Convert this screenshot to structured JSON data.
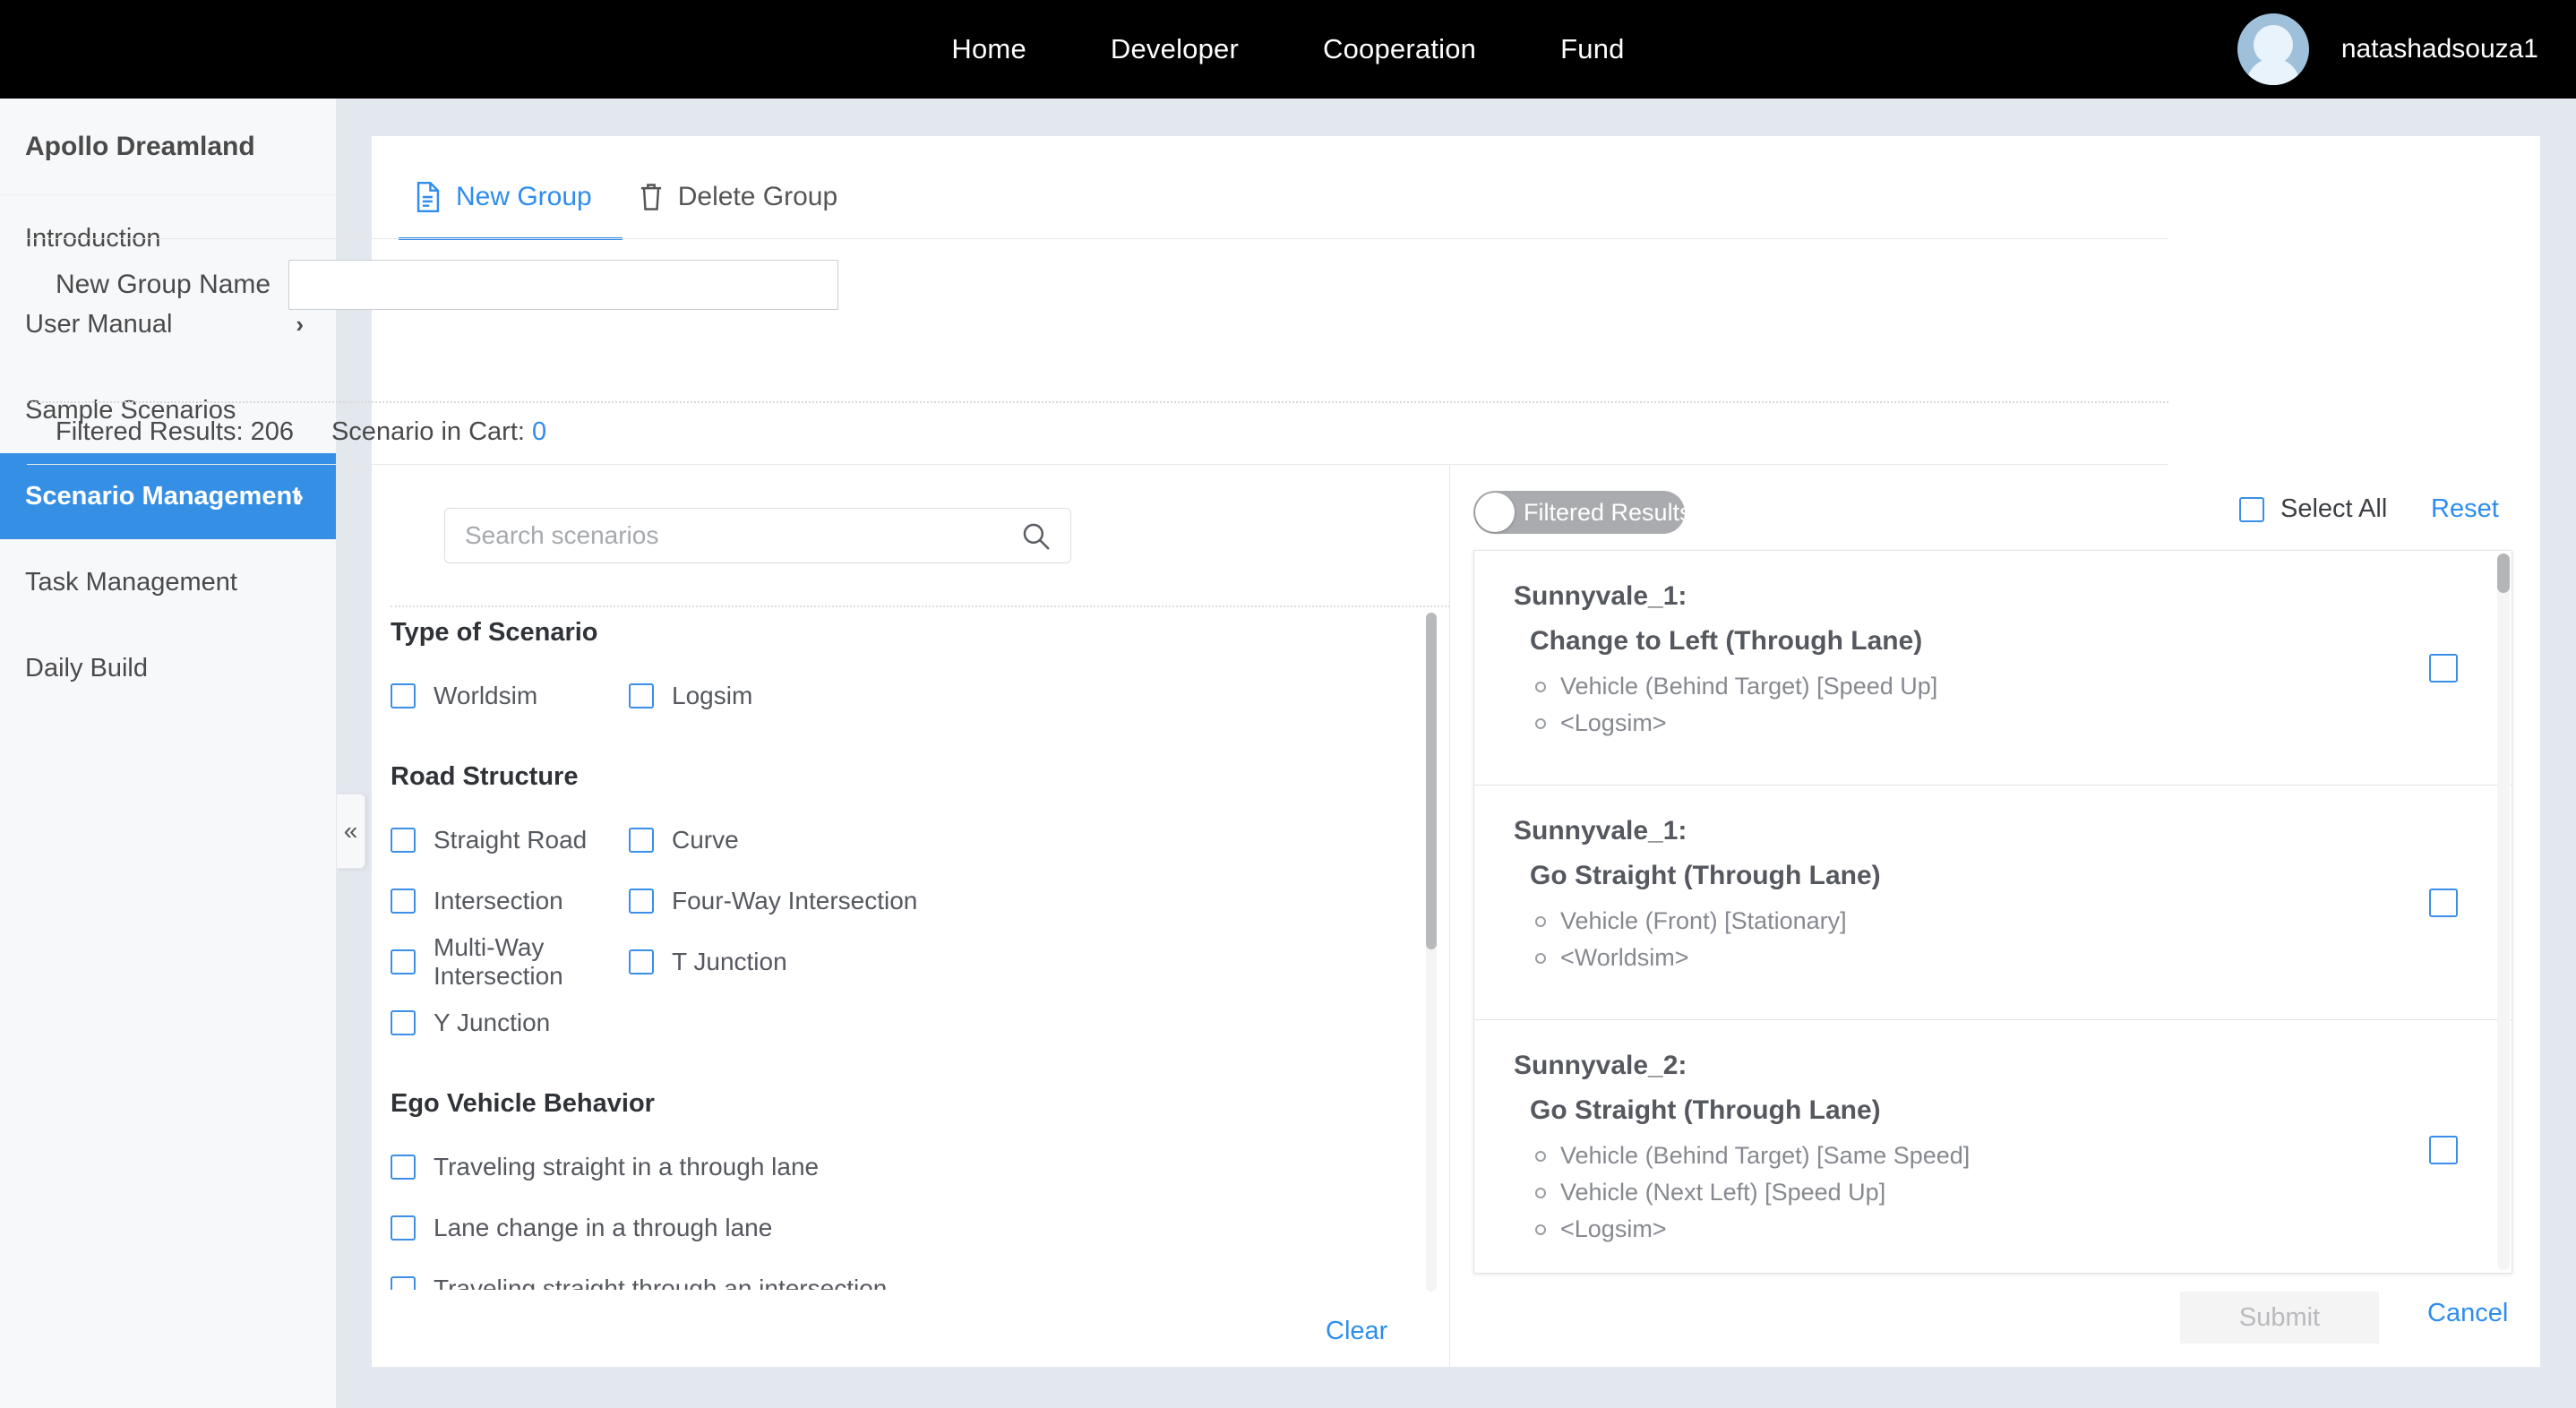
{
  "topnav": {
    "links": [
      {
        "label": "Home"
      },
      {
        "label": "Developer"
      },
      {
        "label": "Cooperation"
      },
      {
        "label": "Fund"
      }
    ],
    "username": "natashadsouza1"
  },
  "sidebar": {
    "brand": "Apollo Dreamland",
    "collapse_icon": "«",
    "items": [
      {
        "label": "Introduction",
        "chevron": "",
        "active": false
      },
      {
        "label": "User Manual",
        "chevron": "›",
        "active": false
      },
      {
        "label": "Sample Scenarios",
        "chevron": "",
        "active": false
      },
      {
        "label": "Scenario Management",
        "chevron": "›",
        "active": true
      },
      {
        "label": "Task Management",
        "chevron": "",
        "active": false
      },
      {
        "label": "Daily Build",
        "chevron": "",
        "active": false
      }
    ]
  },
  "tabs": [
    {
      "label": "New Group",
      "icon": "document-icon",
      "active": true
    },
    {
      "label": "Delete Group",
      "icon": "trash-icon",
      "active": false
    }
  ],
  "form": {
    "group_name_label": "New Group Name",
    "group_name_value": "",
    "group_name_placeholder": ""
  },
  "counts": {
    "filtered_label": "Filtered Results: 206",
    "cart_label": "Scenario in Cart:",
    "cart_value": "0"
  },
  "search": {
    "placeholder": "Search scenarios",
    "value": ""
  },
  "filters": [
    {
      "title": "Type of Scenario",
      "layout": "two-col-narrow",
      "options": [
        {
          "label": "Worldsim",
          "checked": false
        },
        {
          "label": "Logsim",
          "checked": false
        }
      ]
    },
    {
      "title": "Road Structure",
      "layout": "two-col",
      "options": [
        {
          "label": "Straight Road",
          "checked": false
        },
        {
          "label": "Curve",
          "checked": false
        },
        {
          "label": "Intersection",
          "checked": false
        },
        {
          "label": "Four-Way Intersection",
          "checked": false
        },
        {
          "label": "Multi-Way Intersection",
          "checked": false
        },
        {
          "label": "T Junction",
          "checked": false
        },
        {
          "label": "Y Junction",
          "checked": false
        }
      ]
    },
    {
      "title": "Ego Vehicle Behavior",
      "layout": "one-col",
      "options": [
        {
          "label": "Traveling straight in a through lane",
          "checked": false
        },
        {
          "label": "Lane change in a through lane",
          "checked": false
        },
        {
          "label": "Traveling straight through an intersection",
          "checked": false
        }
      ]
    }
  ],
  "filter_actions": {
    "clear_label": "Clear"
  },
  "results": {
    "toggle_label": "Filtered Results",
    "toggle_on": false,
    "select_all_label": "Select All",
    "select_all_checked": false,
    "reset_label": "Reset",
    "cards": [
      {
        "location": "Sunnyvale_1:",
        "title": "Change to Left (Through Lane)",
        "details": [
          "Vehicle (Behind Target) [Speed Up]",
          "<Logsim>"
        ],
        "checked": false
      },
      {
        "location": "Sunnyvale_1:",
        "title": "Go Straight (Through Lane)",
        "details": [
          "Vehicle (Front) [Stationary]",
          "<Worldsim>"
        ],
        "checked": false
      },
      {
        "location": "Sunnyvale_2:",
        "title": "Go Straight (Through Lane)",
        "details": [
          "Vehicle (Behind Target) [Same Speed]",
          "Vehicle (Next Left) [Speed Up]",
          "<Logsim>"
        ],
        "checked": false
      }
    ]
  },
  "footer": {
    "submit_label": "Submit",
    "submit_disabled": true,
    "cancel_label": "Cancel"
  },
  "colors": {
    "accent_blue": "#2e8ded",
    "sidebar_active": "#358fe4",
    "checkbox_border": "#3b8fe8",
    "page_bg": "#e3e7ee",
    "topnav_bg": "#000000"
  }
}
